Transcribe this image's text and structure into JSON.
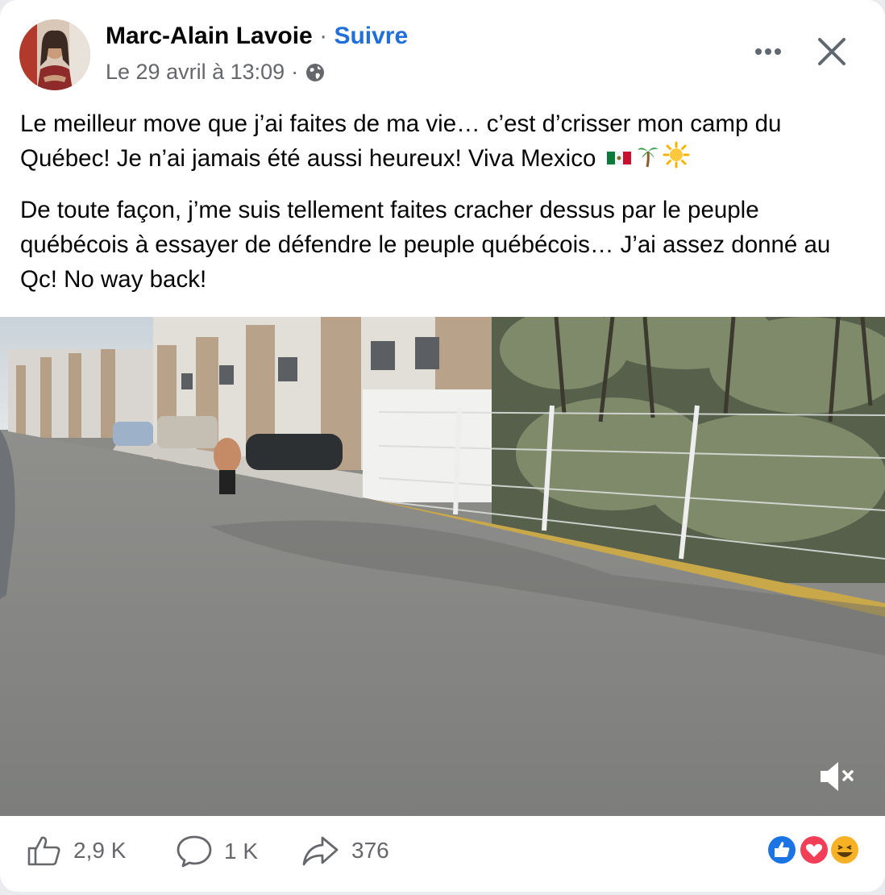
{
  "post": {
    "author": "Marc-Alain Lavoie",
    "separator": "·",
    "follow_label": "Suivre",
    "timestamp": "Le 29 avril à 13:09",
    "meta_separator": "·",
    "audience_icon": "globe-icon",
    "paragraph_1": "Le meilleur move que j’ai faites de ma vie… c’est d’crisser mon camp du Québec! Je n’ai jamais été aussi heureux! Viva Mexico",
    "paragraph_1_emojis": [
      "mexico-flag-icon",
      "palm-tree-icon",
      "sun-icon"
    ],
    "paragraph_2": "De toute façon, j’me suis tellement faites cracher dessus par le peuple québécois à essayer de défendre le peuple québécois… J’ai assez donné au Qc! No way back!"
  },
  "header_controls": {
    "more_icon": "more-icon",
    "close_icon": "close-icon"
  },
  "video": {
    "description_icon": "video-player",
    "mute_icon": "speaker-muted-icon"
  },
  "footer": {
    "like_count": "2,9 K",
    "comment_count": "1 K",
    "share_count": "376",
    "reactions": [
      "like-reaction-icon",
      "love-reaction-icon",
      "haha-reaction-icon"
    ]
  },
  "colors": {
    "follow": "#216fdb",
    "secondary_text": "#65676b",
    "like_blue": "#1b74e4",
    "love_red": "#f33e58",
    "haha_yellow": "#f7b125"
  }
}
